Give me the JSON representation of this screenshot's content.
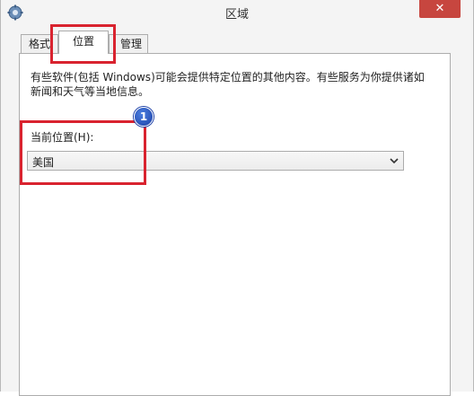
{
  "window": {
    "title": "区域",
    "close_label": "✕"
  },
  "tabs": [
    {
      "label": "格式",
      "active": false
    },
    {
      "label": "位置",
      "active": true
    },
    {
      "label": "管理",
      "visible_text": "管理",
      "active": false
    }
  ],
  "location": {
    "description": "有些软件(包括 Windows)可能会提供特定位置的其他内容。有些服务为你提供诸如新闻和天气等当地信息。",
    "current_label": "当前位置(H):",
    "selected_value": "美国"
  },
  "annotation": {
    "step_badge": "1",
    "highlight_color": "#d9232f",
    "badge_color": "#1c3fa6"
  },
  "colors": {
    "close_button": "#c7463f",
    "panel_border": "#adadad"
  },
  "icons": {
    "app": "region-settings-icon",
    "dropdown": "chevron-down-icon"
  }
}
